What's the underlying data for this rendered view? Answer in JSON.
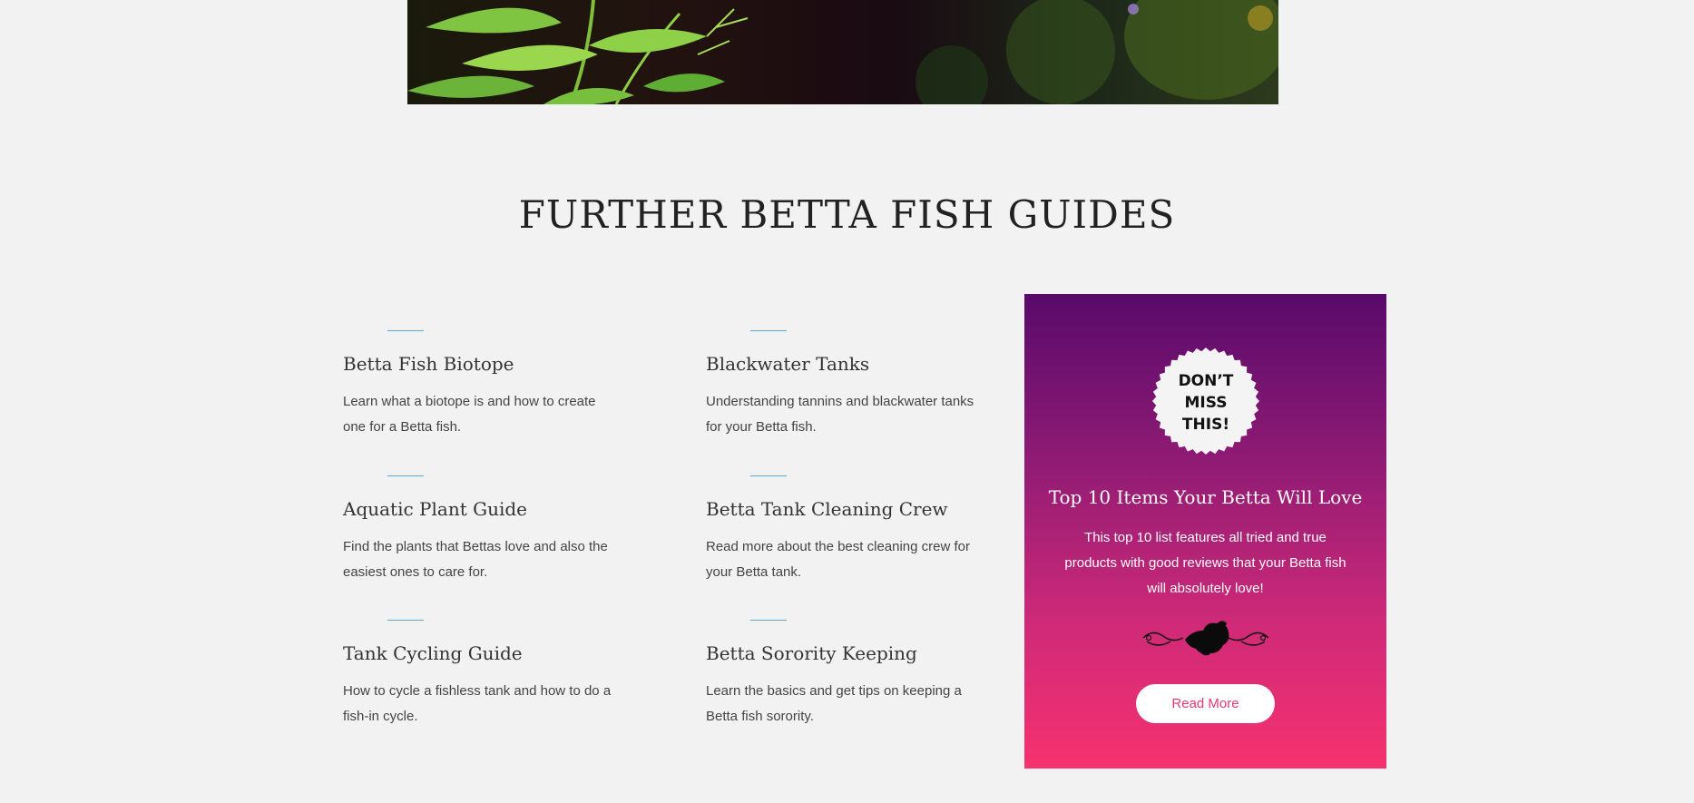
{
  "section": {
    "title": "FURTHER BETTA FISH GUIDES"
  },
  "guides": [
    {
      "title": "Betta Fish Biotope",
      "description": "Learn what a biotope is and how to create one for a Betta fish."
    },
    {
      "title": "Blackwater Tanks",
      "description": "Understanding tannins and blackwater tanks for your Betta fish."
    },
    {
      "title": "Aquatic Plant Guide",
      "description": "Find the plants that Bettas love and also the easiest ones to care for."
    },
    {
      "title": "Betta Tank Cleaning Crew",
      "description": "Read more about the best cleaning crew for your Betta tank."
    },
    {
      "title": "Tank Cycling Guide",
      "description": "How to cycle a fishless tank and how to do a fish-in cycle."
    },
    {
      "title": "Betta Sorority Keeping",
      "description": "Learn the basics and get tips on keeping a Betta fish sorority."
    }
  ],
  "promo": {
    "badge_text": "DON’T\nMISS\nTHIS!",
    "title": "Top 10 Items Your Betta Will Love",
    "description": "This top 10 list features all tried and true products with good reviews that your Betta fish will absolutely love!",
    "button_label": "Read More"
  },
  "colors": {
    "background": "#f2f2f2",
    "accent_rule": "#5aa5d8",
    "promo_gradient_top": "#580a6b",
    "promo_gradient_bottom": "#f6326f",
    "button_text": "#e23a75"
  },
  "icons": {
    "hero": "aquarium-plant-photo",
    "badge": "starburst-badge",
    "ornament": "betta-fish-ornament"
  }
}
